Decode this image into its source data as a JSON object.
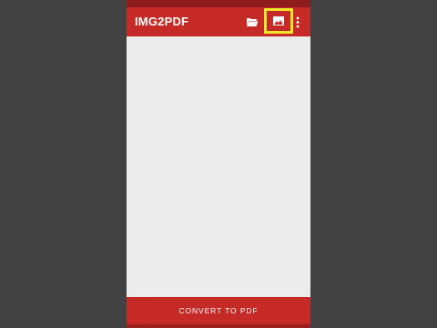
{
  "app": {
    "title": "IMG2PDF"
  },
  "toolbar": {
    "icons": [
      "folder-open-icon",
      "image-icon",
      "more-vert-icon"
    ],
    "highlight_color": "#f3e52c"
  },
  "footer": {
    "convert_label": "CONVERT TO PDF"
  },
  "colors": {
    "primary": "#c62a26",
    "primary_dark": "#8e1c1c",
    "background": "#ececec",
    "outer_background": "#424242"
  }
}
